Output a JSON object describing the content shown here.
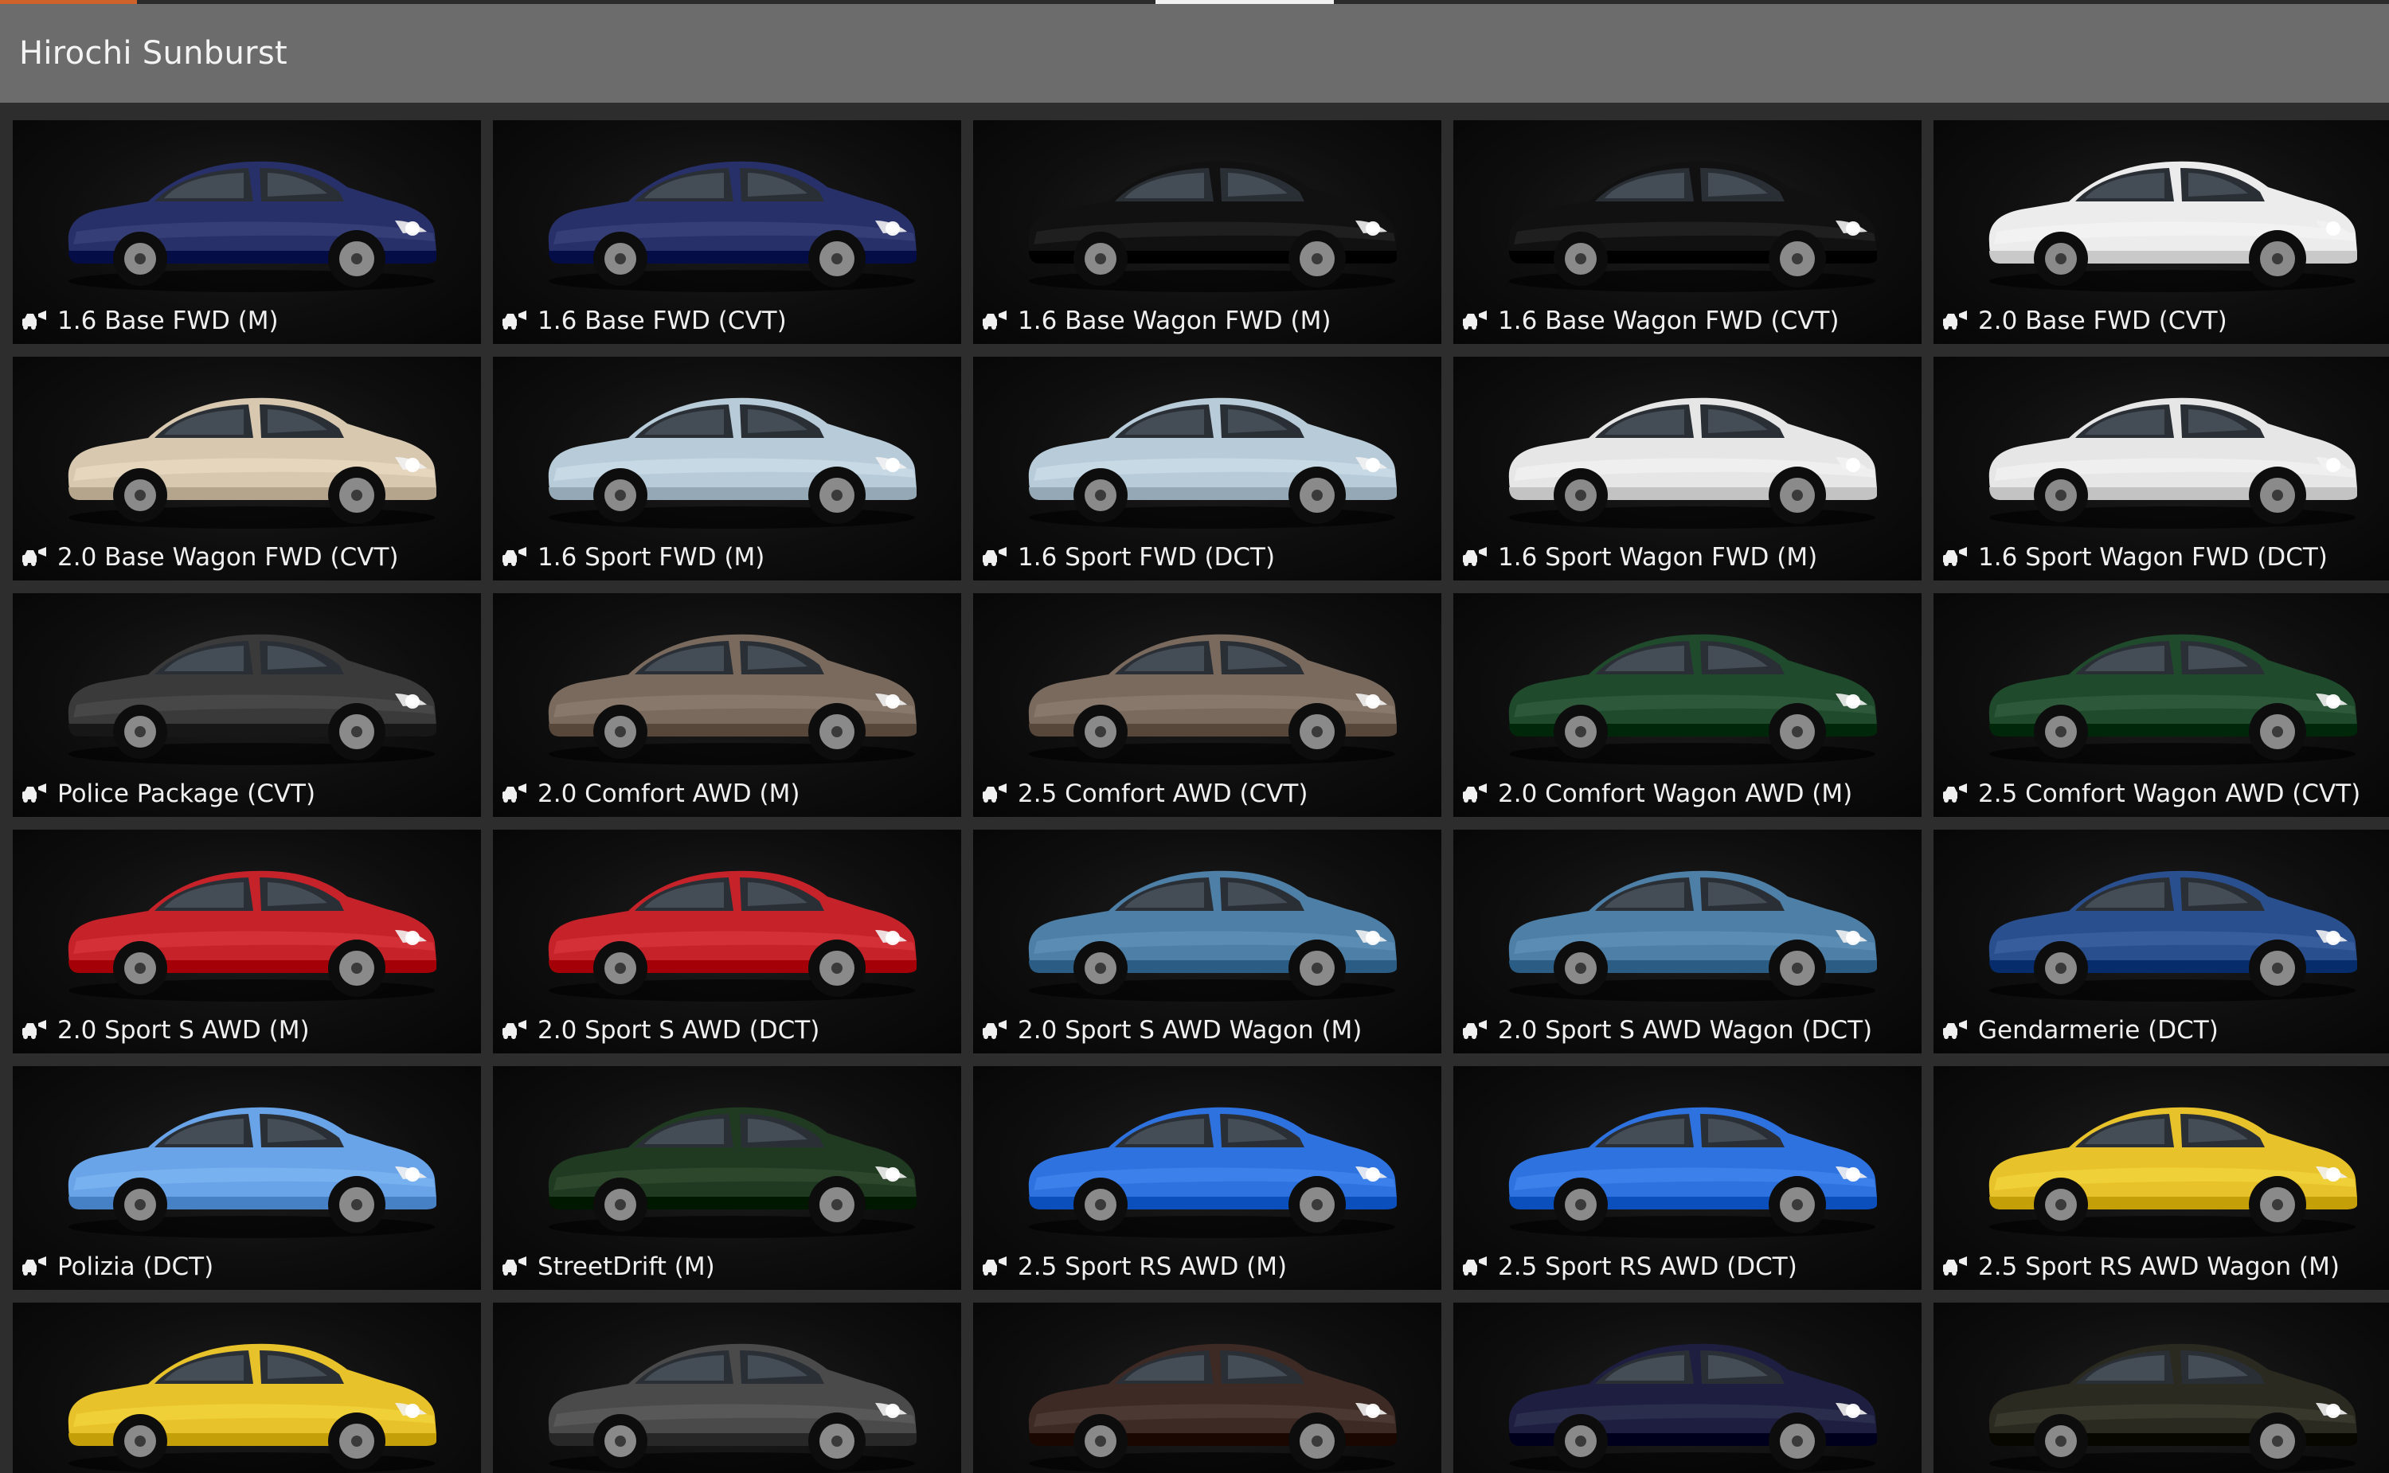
{
  "header": {
    "title": "Hirochi Sunburst"
  },
  "configs": [
    {
      "label": "1.6 Base FWD (M)",
      "color": "#28306a"
    },
    {
      "label": "1.6 Base FWD (CVT)",
      "color": "#28306a"
    },
    {
      "label": "1.6 Base Wagon FWD (M)",
      "color": "#111111"
    },
    {
      "label": "1.6 Base Wagon FWD (CVT)",
      "color": "#111111"
    },
    {
      "label": "2.0 Base FWD (CVT)",
      "color": "#ececec"
    },
    {
      "label": "2.0 Base Wagon FWD (CVT)",
      "color": "#d8c8b0"
    },
    {
      "label": "1.6 Sport FWD (M)",
      "color": "#b8cbd8"
    },
    {
      "label": "1.6 Sport FWD (DCT)",
      "color": "#b8cbd8"
    },
    {
      "label": "1.6 Sport Wagon FWD (M)",
      "color": "#e6e6e6"
    },
    {
      "label": "1.6 Sport Wagon FWD (DCT)",
      "color": "#e6e6e6"
    },
    {
      "label": "Police Package (CVT)",
      "color": "#3a3a3a"
    },
    {
      "label": "2.0 Comfort AWD (M)",
      "color": "#7a6a5e"
    },
    {
      "label": "2.5 Comfort AWD (CVT)",
      "color": "#7a6a5e"
    },
    {
      "label": "2.0 Comfort Wagon AWD (M)",
      "color": "#1f4a2c"
    },
    {
      "label": "2.5 Comfort Wagon AWD (CVT)",
      "color": "#1f4a2c"
    },
    {
      "label": "2.0 Sport S AWD (M)",
      "color": "#c6222a"
    },
    {
      "label": "2.0 Sport S AWD (DCT)",
      "color": "#c6222a"
    },
    {
      "label": "2.0 Sport S AWD Wagon (M)",
      "color": "#4e7fa6"
    },
    {
      "label": "2.0 Sport S AWD Wagon (DCT)",
      "color": "#4e7fa6"
    },
    {
      "label": "Gendarmerie (DCT)",
      "color": "#2a4f8e"
    },
    {
      "label": "Polizia (DCT)",
      "color": "#6aa4e8"
    },
    {
      "label": "StreetDrift (M)",
      "color": "#1f3a20"
    },
    {
      "label": "2.5 Sport RS AWD (M)",
      "color": "#2e72e0"
    },
    {
      "label": "2.5 Sport RS AWD (DCT)",
      "color": "#2e72e0"
    },
    {
      "label": "2.5 Sport RS AWD Wagon (M)",
      "color": "#e8c22a"
    },
    {
      "label": "",
      "color": "#e8c22a"
    },
    {
      "label": "",
      "color": "#4a4a4a"
    },
    {
      "label": "",
      "color": "#3e2a24"
    },
    {
      "label": "",
      "color": "#1e1f40"
    },
    {
      "label": "",
      "color": "#2a2a20"
    }
  ],
  "icons": {
    "vehicle": "car-config-icon"
  }
}
